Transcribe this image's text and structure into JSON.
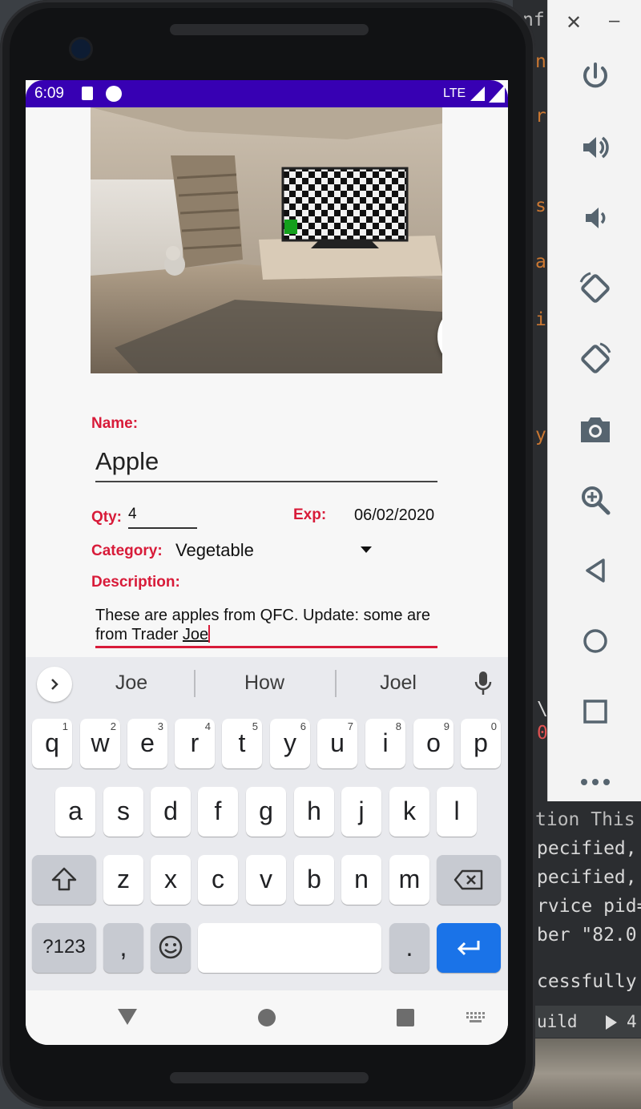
{
  "status_bar": {
    "time": "6:09",
    "network": "LTE"
  },
  "form": {
    "name_label": "Name:",
    "name_value": "Apple",
    "qty_label": "Qty:",
    "qty_value": "4",
    "exp_label": "Exp:",
    "exp_value": "06/02/2020",
    "category_label": "Category:",
    "category_value": "Vegetable",
    "description_label": "Description:",
    "description_value": "These are apples from QFC. Update: some are from Trader ",
    "description_current_word": "Joe"
  },
  "keyboard": {
    "suggestions": [
      "Joe",
      "How",
      "Joel"
    ],
    "row1": [
      {
        "label": "q",
        "hint": "1"
      },
      {
        "label": "w",
        "hint": "2"
      },
      {
        "label": "e",
        "hint": "3"
      },
      {
        "label": "r",
        "hint": "4"
      },
      {
        "label": "t",
        "hint": "5"
      },
      {
        "label": "y",
        "hint": "6"
      },
      {
        "label": "u",
        "hint": "7"
      },
      {
        "label": "i",
        "hint": "8"
      },
      {
        "label": "o",
        "hint": "9"
      },
      {
        "label": "p",
        "hint": "0"
      }
    ],
    "row2": [
      "a",
      "s",
      "d",
      "f",
      "g",
      "h",
      "j",
      "k",
      "l"
    ],
    "row3": [
      "z",
      "x",
      "c",
      "v",
      "b",
      "n",
      "m"
    ],
    "symbols_label": "?123",
    "comma_label": ",",
    "period_label": "."
  },
  "ide": {
    "code_fragments": [
      "nf",
      "ng",
      "rt",
      "s",
      "ar",
      "io",
      "y",
      "\\",
      "0",
      "tion  This",
      "pecified,",
      "pecified,",
      "rvice pid=",
      "ber \"82.0",
      "cessfully f",
      "uild",
      "4"
    ]
  },
  "icons": [
    "add-photo-icon",
    "dropdown-arrow-icon",
    "mic-icon",
    "chevron-right-icon",
    "shift-icon",
    "backspace-icon",
    "emoji-icon",
    "enter-icon",
    "power-icon",
    "volume-up-icon",
    "volume-down-icon",
    "rotate-left-icon",
    "rotate-right-icon",
    "camera-icon",
    "zoom-icon",
    "back-icon",
    "home-icon",
    "overview-icon",
    "more-icon"
  ],
  "colors": {
    "status_bar": "#3700b3",
    "label_red": "#d81b39",
    "enter_blue": "#1a73e8"
  }
}
